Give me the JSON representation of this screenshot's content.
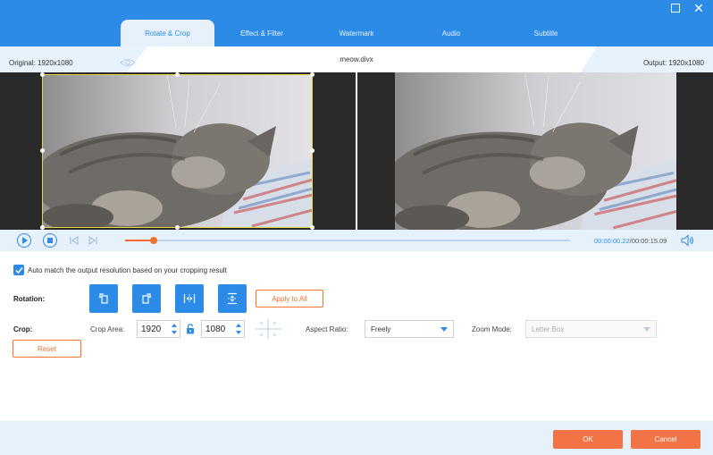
{
  "tabs": [
    "Rotate & Crop",
    "Effect & Filter",
    "Watermark",
    "Audio",
    "Subtitle"
  ],
  "active_tab": 0,
  "info": {
    "original": "Original: 1920x1080",
    "file_name": "meow.divx",
    "output": "Output: 1920x1080"
  },
  "player": {
    "current_time": "00:00:00.22",
    "separator": "/",
    "total_time": "00:00:15.09",
    "progress_fraction": 0.064
  },
  "auto_match": {
    "checked": true,
    "label": "Auto match the output resolution based on your cropping result"
  },
  "rotation": {
    "label": "Rotation:",
    "apply_all_label": "Apply to All"
  },
  "crop": {
    "label": "Crop:",
    "area_label": "Crop Area:",
    "width": "1920",
    "height": "1080",
    "aspect_label": "Aspect Ratio:",
    "aspect_value": "Freely",
    "zoom_label": "Zoom Mode:",
    "zoom_value": "Letter Box",
    "reset_label": "Reset"
  },
  "footer": {
    "ok_label": "OK",
    "cancel_label": "Cancel"
  },
  "colors": {
    "accent": "#2b8be6",
    "orange": "#f27346",
    "panel": "#e6f1fb"
  }
}
